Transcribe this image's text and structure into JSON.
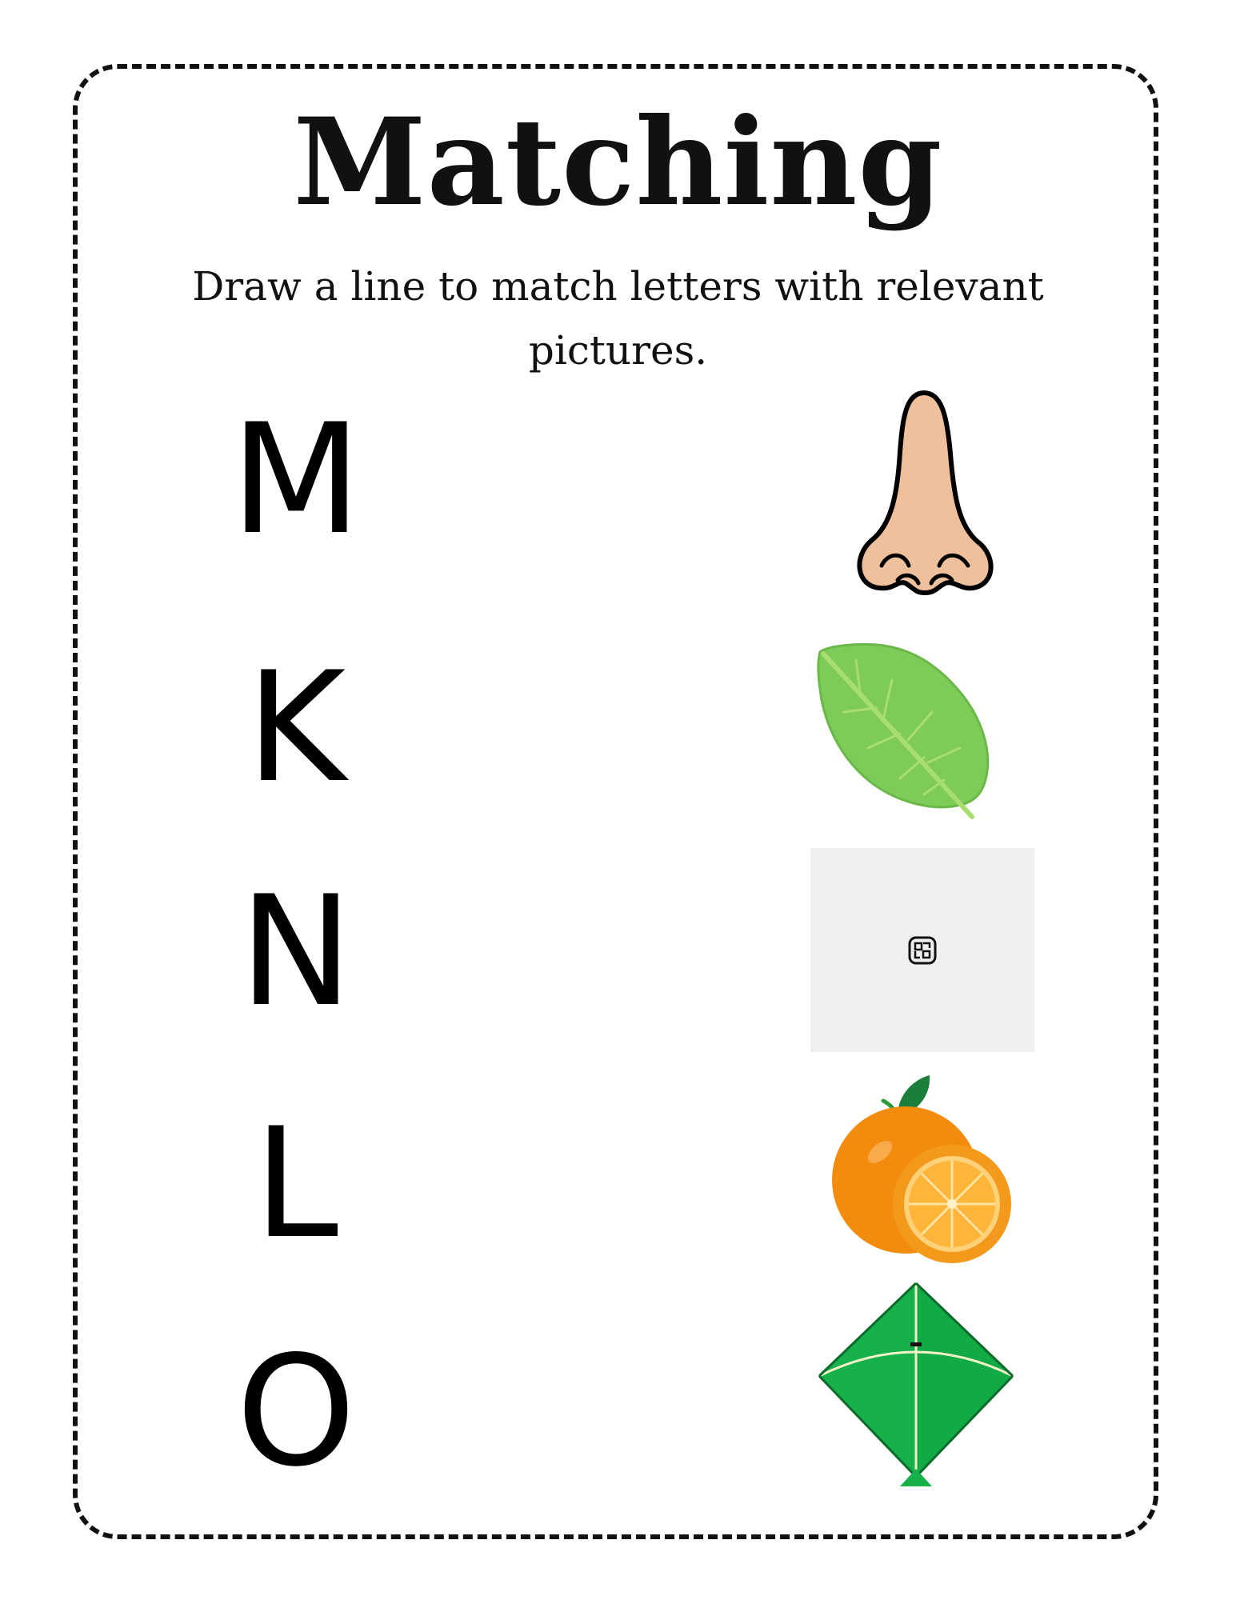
{
  "worksheet": {
    "title": "Matching",
    "instructions": "Draw a line to match letters with relevant pictures."
  },
  "letters": [
    "M",
    "K",
    "N",
    "L",
    "O"
  ],
  "pictures": [
    {
      "icon": "nose-icon"
    },
    {
      "icon": "leaf-icon"
    },
    {
      "icon": "image-placeholder-icon"
    },
    {
      "icon": "orange-icon"
    },
    {
      "icon": "kite-icon"
    }
  ],
  "colors": {
    "border": "#111111",
    "nose": "#efc09c",
    "leaf": "#7ecb5a",
    "orange": "#f28c0f",
    "kite": "#16b14a",
    "placeholder": "#efefef"
  }
}
